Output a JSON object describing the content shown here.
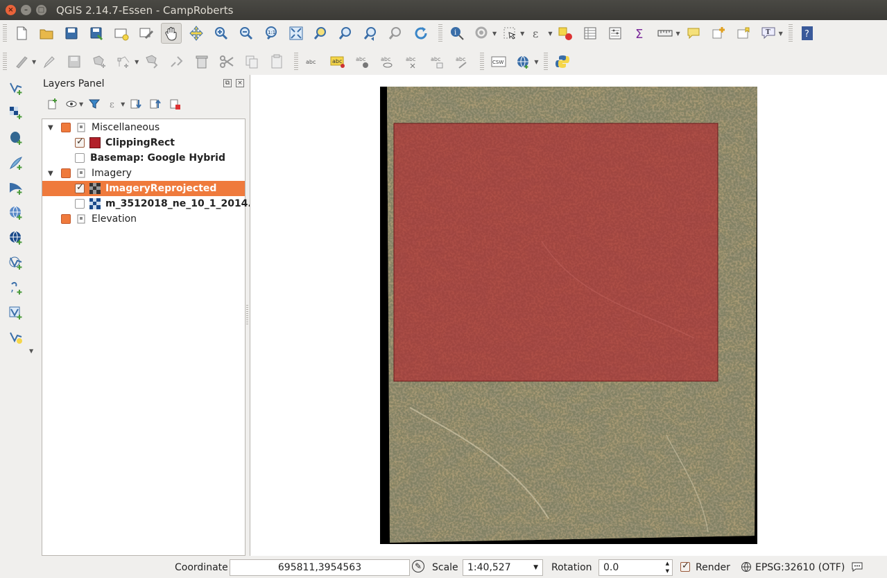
{
  "window": {
    "title": "QGIS 2.14.7-Essen - CampRoberts"
  },
  "layers_panel": {
    "title": "Layers Panel",
    "rows": [
      {
        "label": "Miscellaneous",
        "type": "group",
        "checked": true
      },
      {
        "label": "ClippingRect",
        "type": "layer",
        "checked": true,
        "color": "#b2202a"
      },
      {
        "label": "Basemap: Google Hybrid",
        "type": "layer",
        "checked": false
      },
      {
        "label": "Imagery",
        "type": "group",
        "checked": true
      },
      {
        "label": "ImageryReprojected",
        "type": "raster",
        "checked": true,
        "selected": true
      },
      {
        "label": "m_3512018_ne_10_1_2014...",
        "type": "raster",
        "checked": false
      },
      {
        "label": "Elevation",
        "type": "group",
        "checked": true
      }
    ]
  },
  "status": {
    "coordinate_label": "Coordinate",
    "coordinate_value": "695811,3954563",
    "scale_label": "Scale",
    "scale_value": "1:40,527",
    "rotation_label": "Rotation",
    "rotation_value": "0.0",
    "render_label": "Render",
    "crs": "EPSG:32610 (OTF)"
  },
  "colors": {
    "selection": "#ef7a3c",
    "clip_rect": "#b2202a",
    "titlebar": "#3b3a36"
  },
  "toolbar_icons": {
    "row1": [
      "new-project-icon",
      "open-project-icon",
      "save-project-icon",
      "save-as-icon",
      "new-print-composer-icon",
      "composer-manager-icon",
      "pan-icon",
      "pan-to-selection-icon",
      "zoom-in-icon",
      "zoom-out-icon",
      "zoom-actual-icon",
      "zoom-full-icon",
      "zoom-to-selection-icon",
      "zoom-to-layer-icon",
      "zoom-last-icon",
      "zoom-next-icon",
      "refresh-icon",
      "identify-icon",
      "run-action-icon",
      "select-icon",
      "select-by-expression-icon",
      "deselect-icon",
      "attribute-table-icon",
      "field-calculator-icon",
      "statistics-icon",
      "measure-icon",
      "map-tips-icon",
      "new-bookmark-icon",
      "show-bookmarks-icon",
      "text-annotation-icon",
      "help-icon"
    ],
    "row2": [
      "current-edits-icon",
      "toggle-editing-icon",
      "save-edits-icon",
      "add-feature-icon",
      "move-feature-icon",
      "node-tool-icon",
      "delete-selected-icon",
      "cut-features-icon",
      "copy-features-icon",
      "paste-features-icon",
      "label-icon",
      "pin-labels-icon",
      "show-hide-labels-icon",
      "move-label-icon",
      "rotate-label-icon",
      "change-label-icon",
      "csw-icon",
      "metasearch-icon",
      "python-console-icon"
    ]
  }
}
